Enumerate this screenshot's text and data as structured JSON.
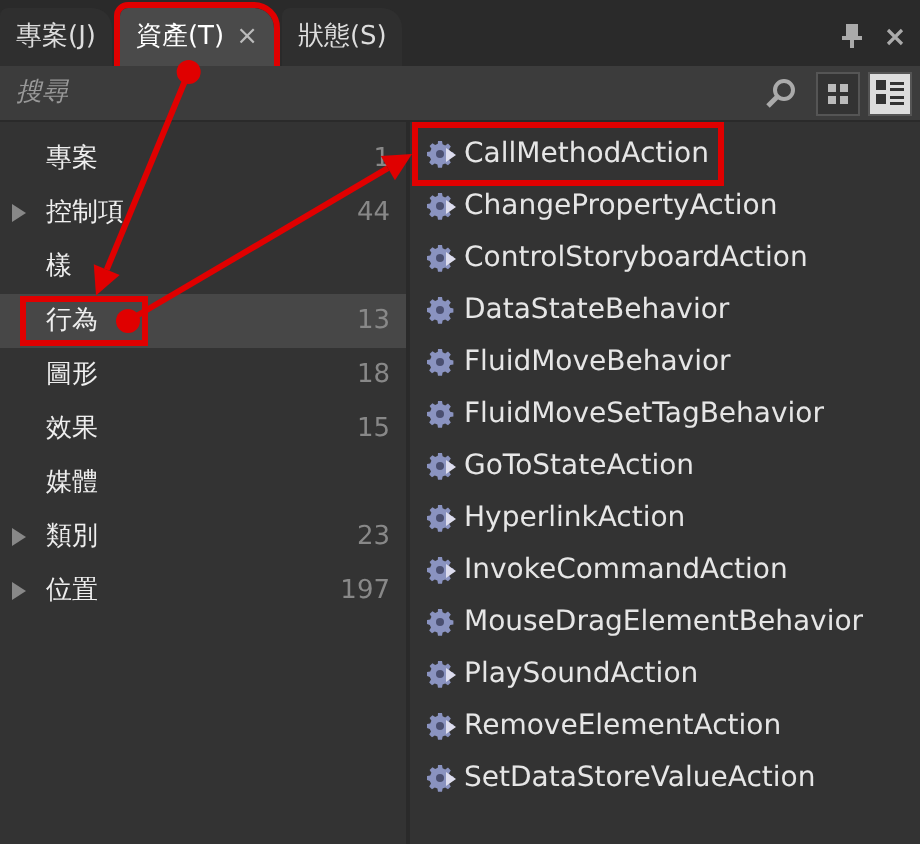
{
  "tabs": [
    {
      "label": "專案(J)",
      "selected": false,
      "highlighted": false
    },
    {
      "label": "資產(T)",
      "close": "×",
      "selected": true,
      "highlighted": true,
      "arrow_out": true
    },
    {
      "label": "狀態(S)",
      "selected": false,
      "highlighted": false
    }
  ],
  "search": {
    "placeholder": "搜尋"
  },
  "view_buttons": [
    {
      "kind": "grid",
      "selected": false
    },
    {
      "kind": "list",
      "selected": true
    }
  ],
  "categories": [
    {
      "label": "專案",
      "count": "1",
      "expandable": false,
      "selected": false,
      "highlighted": false
    },
    {
      "label": "控制項",
      "count": "44",
      "expandable": true,
      "selected": false,
      "highlighted": false
    },
    {
      "label": "樣",
      "expandable": false,
      "selected": false,
      "highlighted": false
    },
    {
      "label": "行為",
      "count": "13",
      "expandable": false,
      "selected": true,
      "highlighted": true,
      "arrow_out": true
    },
    {
      "label": "圖形",
      "count": "18",
      "expandable": false,
      "selected": false,
      "highlighted": false
    },
    {
      "label": "效果",
      "count": "15",
      "expandable": false,
      "selected": false,
      "highlighted": false
    },
    {
      "label": "媒體",
      "expandable": false,
      "selected": false,
      "highlighted": false
    },
    {
      "label": "類別",
      "count": "23",
      "expandable": true,
      "selected": false,
      "highlighted": false
    },
    {
      "label": "位置",
      "count": "197",
      "expandable": true,
      "selected": false,
      "highlighted": false
    }
  ],
  "items": [
    {
      "label": "CallMethodAction",
      "kind": "action",
      "highlighted": true
    },
    {
      "label": "ChangePropertyAction",
      "kind": "action",
      "highlighted": false
    },
    {
      "label": "ControlStoryboardAction",
      "kind": "action",
      "highlighted": false
    },
    {
      "label": "DataStateBehavior",
      "kind": "behavior",
      "highlighted": false
    },
    {
      "label": "FluidMoveBehavior",
      "kind": "behavior",
      "highlighted": false
    },
    {
      "label": "FluidMoveSetTagBehavior",
      "kind": "behavior",
      "highlighted": false
    },
    {
      "label": "GoToStateAction",
      "kind": "action",
      "highlighted": false
    },
    {
      "label": "HyperlinkAction",
      "kind": "action",
      "highlighted": false
    },
    {
      "label": "InvokeCommandAction",
      "kind": "action",
      "highlighted": false
    },
    {
      "label": "MouseDragElementBehavior",
      "kind": "behavior",
      "highlighted": false
    },
    {
      "label": "PlaySoundAction",
      "kind": "action",
      "highlighted": false
    },
    {
      "label": "RemoveElementAction",
      "kind": "action",
      "highlighted": false
    },
    {
      "label": "SetDataStoreValueAction",
      "kind": "action",
      "highlighted": false
    }
  ]
}
